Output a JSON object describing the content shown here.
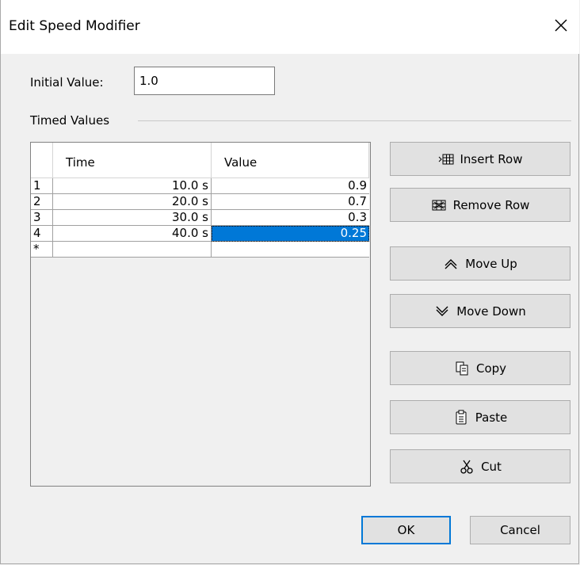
{
  "window": {
    "title": "Edit Speed Modifier"
  },
  "initial": {
    "label": "Initial Value:",
    "value": "1.0"
  },
  "timed": {
    "label": "Timed Values",
    "columns": {
      "time": "Time",
      "value": "Value"
    },
    "rows": [
      {
        "num": "1",
        "time": "10.0 s",
        "value": "0.9"
      },
      {
        "num": "2",
        "time": "20.0 s",
        "value": "0.7"
      },
      {
        "num": "3",
        "time": "30.0 s",
        "value": "0.3"
      },
      {
        "num": "4",
        "time": "40.0 s",
        "value": "0.25"
      }
    ],
    "new_row_marker": "*"
  },
  "buttons": {
    "insert_row": "Insert Row",
    "remove_row": "Remove Row",
    "move_up": "Move Up",
    "move_down": "Move Down",
    "copy": "Copy",
    "paste": "Paste",
    "cut": "Cut",
    "ok": "OK",
    "cancel": "Cancel"
  },
  "colors": {
    "selection": "#0078d7",
    "accent": "#0078d7"
  },
  "icons": [
    "close-icon",
    "insert-row-icon",
    "remove-row-icon",
    "move-up-icon",
    "move-down-icon",
    "copy-icon",
    "paste-icon",
    "cut-icon"
  ]
}
